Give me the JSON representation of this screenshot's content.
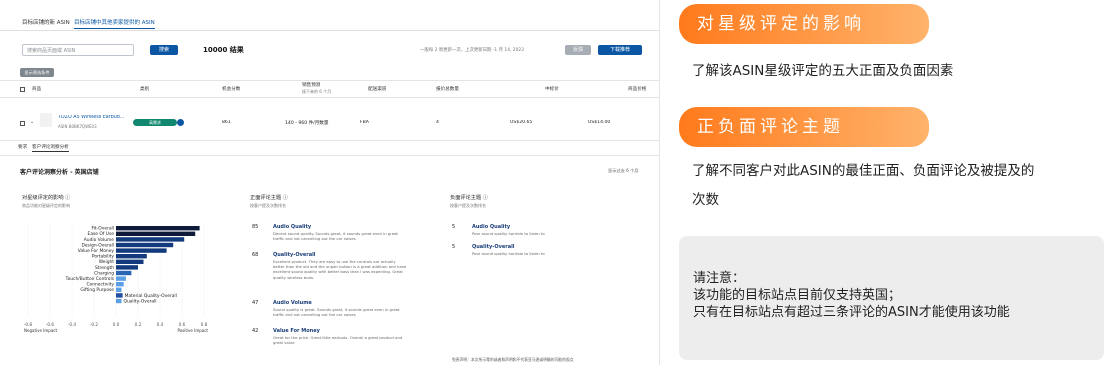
{
  "left": {
    "tabs": [
      "目标店铺的新 ASIN",
      "目标店铺中其他卖家提供的 ASIN"
    ],
    "search": {
      "placeholder": "搜索商品页面或 ASIN",
      "button": "搜索",
      "results": "10000 结果"
    },
    "update_note": "一般每 2 周更新一次，上次更新日期 -1 月 14, 2023",
    "buttons": {
      "hide": "反馈",
      "download": "下载推荐"
    },
    "filter_btn": "显示筛选条件",
    "columns": [
      "商品",
      "类别",
      "机会分数",
      "销售预测",
      "配送渠道",
      "报价总数量",
      "中标价",
      "商品价格"
    ],
    "sales_sub": "接下来的 6 个月",
    "row": {
      "title": "TOZO A5 Wireless Earbud...",
      "asin": "ASIN B0BK7QWE03",
      "badge": "高需求",
      "score": "861",
      "sales": "140 - 960 件/月数量",
      "channel": "FBA",
      "offers": "4",
      "win_price": "US$20.65",
      "price": "US$14.00"
    },
    "subtabs": [
      "要求",
      "客户评论洞察分析"
    ],
    "insight_title": "客户评论洞察分析 - 英国店铺",
    "insight_period": "显示过去 6 个月",
    "impact": {
      "title": "对星级评定的影响 ⓘ",
      "sub": "商品功能对星级评定的影响",
      "x_ticks": [
        "-0.8",
        "-0.6",
        "-0.4",
        "-0.2",
        "0.0",
        "0.2",
        "0.4",
        "0.6",
        "0.8"
      ],
      "neg_label": "Negative Impact",
      "pos_label": "Positive Impact"
    },
    "positive": {
      "title": "正面评论主题 ⓘ",
      "sub": "按客户提及次数排名",
      "items": [
        {
          "count": "85",
          "name": "Audio Quality",
          "desc": "Decent sound quality. Sounds great, it sounds great even in great traffic and not cancelling out the car noises"
        },
        {
          "count": "68",
          "name": "Quality-Overall",
          "desc": "Excellent product. They are easy to use the controls are actually better than the old and the unpair button is a great addition and have excellent sound quality with better bass than I was expecting. Great quality wireless buds."
        },
        {
          "count": "47",
          "name": "Audio Volume",
          "desc": "Sound quality is great. Sounds great, it sounds great even in great traffic and not cancelling out the car noises"
        },
        {
          "count": "42",
          "name": "Value For Money",
          "desc": "Great for the price. Great little earbuds. Overall a great product and great value"
        }
      ]
    },
    "negative": {
      "title": "负面评论主题 ⓘ",
      "sub": "按客户提及次数排名",
      "items": [
        {
          "count": "5",
          "name": "Audio Quality",
          "desc": "Poor sound quality horrible to listen to"
        },
        {
          "count": "5",
          "name": "Quality-Overall",
          "desc": "Poor sound quality horrible to listen to"
        }
      ]
    },
    "disclaimer": "免责声明：本文所示零的或者和声明和不代表亚马逊或明确的可能的观点"
  },
  "chart_data": {
    "type": "bar",
    "title": "对星级评定的影响",
    "xlabel": "",
    "ylabel": "",
    "xlim": [
      -0.8,
      0.8
    ],
    "categories": [
      "Fit-Overall",
      "Ease Of Use",
      "Audio Volume",
      "Design-Overall",
      "Value For Money",
      "Portability",
      "Weight",
      "Strength",
      "Charging",
      "Touch/Button Controls",
      "Connectivity",
      "Gifting Purpose",
      "Material Quality-Overall",
      "Quality-Overall"
    ],
    "values": [
      0.76,
      0.72,
      0.62,
      0.52,
      0.46,
      0.28,
      0.25,
      0.2,
      0.14,
      0.09,
      0.07,
      0.05,
      0.06,
      0.05
    ],
    "colors": [
      "#0e1a3a",
      "#0e1a3a",
      "#123a7c",
      "#123a7c",
      "#123a7c",
      "#123a7c",
      "#123a7c",
      "#123a7c",
      "#2766b5",
      "#5aa0e6",
      "#5aa0e6",
      "#5aa0e6",
      "#1f4ea3",
      "#5aa0e6"
    ]
  },
  "right": {
    "pill1": "对星级评定的影响",
    "text1": "了解该ASIN星级评定的五大正面及负面因素",
    "pill2": "正负面评论主题",
    "text2a": "了解不同客户对此ASIN的最佳正面、负面评论及被提及的",
    "text2b": "次数",
    "note": [
      "请注意：",
      "该功能的目标站点目前仅支持英国；",
      "只有在目标站点有超过三条评论的ASIN才能使用该功能"
    ],
    "pill_color": "#ff7f24"
  }
}
